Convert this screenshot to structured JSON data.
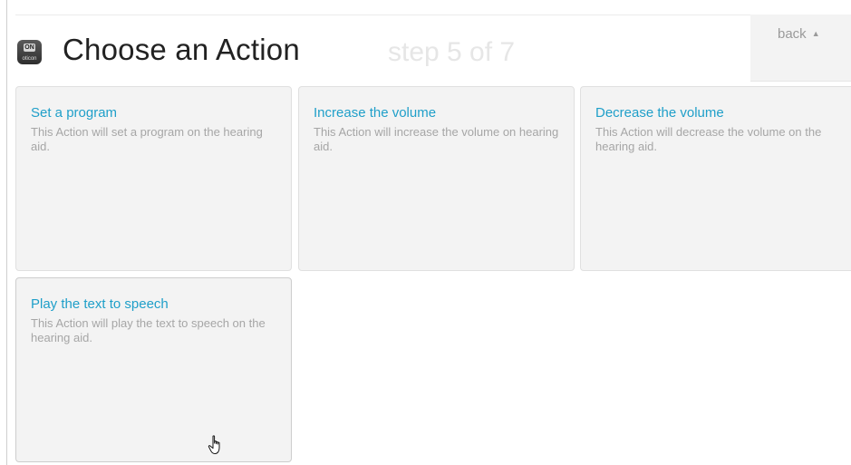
{
  "header": {
    "logo_text_top": "ON",
    "logo_text_bottom": "oticon",
    "title": "Choose an Action",
    "step": "step 5 of 7",
    "back_label": "back",
    "back_icon": "caret-up-icon"
  },
  "actions": [
    {
      "title": "Set a program",
      "description": "This Action will set a program on the hearing aid."
    },
    {
      "title": "Increase the volume",
      "description": "This Action will increase the volume on hearing aid."
    },
    {
      "title": "Decrease the volume",
      "description": "This Action will decrease the volume on the hearing aid."
    },
    {
      "title": "Play the text to speech",
      "description": "This Action will play the text to speech on the hearing aid."
    }
  ],
  "colors": {
    "accent": "#1f9fc9",
    "card_background": "#f3f3f3",
    "muted_text": "#a6a6a6"
  },
  "cursor_icon": "hand-pointer-icon"
}
